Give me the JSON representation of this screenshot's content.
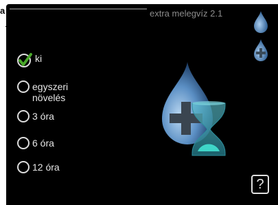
{
  "corner": {
    "label": "a"
  },
  "header": {
    "title": "extra melegvíz 2.1"
  },
  "options": [
    {
      "label": "ki",
      "selected": true
    },
    {
      "label": "egyszeri növelés",
      "selected": false
    },
    {
      "label": "3 óra",
      "selected": false
    },
    {
      "label": "6 óra",
      "selected": false
    },
    {
      "label": "12 óra",
      "selected": false
    }
  ],
  "help": {
    "label": "?"
  },
  "icons": {
    "drop_color": "#5b8fc4",
    "hourglass_color": "#3fd6c8",
    "check_color": "#3a8a1e"
  }
}
